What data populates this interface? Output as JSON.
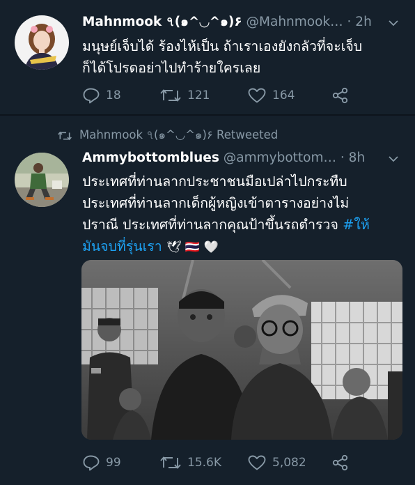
{
  "tweet1": {
    "name": "Mahnmook ৭(๑^◡^๑)۶",
    "handle": "@Mahnmook…",
    "time": "· 2h",
    "text_line1": "มนุษย์เจ็บได้ ร้องไห้เป็น ถ้าเราเองยังกลัวที่จะเจ็บ",
    "text_line2": "ก็ได้โปรดอย่าไปทำร้ายใครเลย",
    "replies": "18",
    "retweets": "121",
    "likes": "164"
  },
  "retweet_banner": {
    "text": "Mahnmook ৭(๑^◡^๑)۶ Retweeted"
  },
  "tweet2": {
    "name": "Ammybottomblues",
    "handle": "@ammybottom…",
    "time": "· 8h",
    "text_line1": "ประเทศที่ท่านลากประชาชนมือเปล่าไปกระทืบ",
    "text_line2": "ประเทศที่ท่านลากเด็กผู้หญิงเข้าตารางอย่างไม่",
    "text_line3": "ปราณี ประเทศที่ท่านลากคุณป้าขึ้นรถตำรวจ ",
    "hashtag_part1": "#ให้",
    "hashtag_part2": "มันจบที่รุ่นเรา",
    "emoji": "🕊 🇹🇭 🤍",
    "replies": "99",
    "retweets": "15.6K",
    "likes": "5,082"
  },
  "colors": {
    "background": "#15202b",
    "secondary_text": "#8899a6",
    "link": "#1da1f2",
    "divider": "#0d141c"
  }
}
